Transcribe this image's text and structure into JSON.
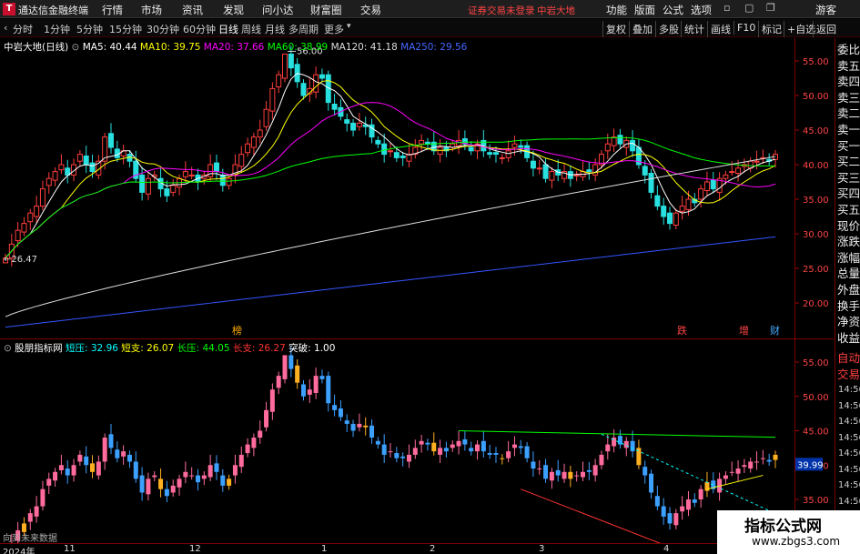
{
  "app": {
    "logo": "T",
    "name": "通达信金融终端",
    "menu": [
      "行情",
      "市场",
      "资讯",
      "发现",
      "问小达",
      "财富圈",
      "交易"
    ],
    "warning": "证券交易未登录",
    "stock_name": "中岩大地",
    "right_menu": [
      "功能",
      "版面",
      "公式",
      "选项"
    ],
    "guest": "游客"
  },
  "toolbar": {
    "periods": [
      "分时",
      "1分钟",
      "5分钟",
      "15分钟",
      "30分钟",
      "60分钟",
      "日线",
      "周线",
      "月线",
      "多周期",
      "更多"
    ],
    "active": "日线",
    "right": [
      "复权",
      "叠加",
      "多股",
      "统计",
      "画线",
      "F10",
      "标记",
      "+自选",
      "返回"
    ]
  },
  "main": {
    "title": "中岩大地(日线)",
    "ma": [
      {
        "label": "MA5: 40.44",
        "color": "#ffffff"
      },
      {
        "label": "MA10: 39.75",
        "color": "#ffff00"
      },
      {
        "label": "MA20: 37.66",
        "color": "#ff00ff"
      },
      {
        "label": "MA60: 38.99",
        "color": "#00ff00"
      },
      {
        "label": "MA120: 41.18",
        "color": "#dddddd"
      },
      {
        "label": "MA250: 29.56",
        "color": "#4466ff"
      }
    ],
    "high_label": "56.00",
    "low_label": "26.47",
    "events": [
      {
        "text": "榜",
        "color": "#ffaa00"
      },
      {
        "text": "跌",
        "color": "#ff4444"
      },
      {
        "text": "增",
        "color": "#ff4444"
      },
      {
        "text": "财",
        "color": "#44aaff"
      }
    ],
    "yticks": [
      "55.00",
      "50.00",
      "45.00",
      "40.00",
      "35.00",
      "30.00",
      "25.00",
      "20.00"
    ]
  },
  "indicator": {
    "title": "股朋指标网",
    "items": [
      {
        "label": "短压: 32.96",
        "color": "#00ffff"
      },
      {
        "label": "短支: 26.07",
        "color": "#ffff00"
      },
      {
        "label": "长压: 44.05",
        "color": "#00ff00"
      },
      {
        "label": "长支: 26.27",
        "color": "#ff3333"
      },
      {
        "label": "突破: 1.00",
        "color": "#ffffff"
      }
    ],
    "yticks": [
      "55.00",
      "50.00",
      "45.00",
      "40.00",
      "35.00"
    ],
    "price_box": "39.99",
    "future_label": "向到未来数据"
  },
  "right_panel": {
    "items": [
      "委比",
      "卖五",
      "卖四",
      "卖三",
      "卖二",
      "卖一",
      "买一",
      "买二",
      "买三",
      "买四",
      "买五",
      "现价",
      "涨跌",
      "涨幅",
      "总量",
      "外盘",
      "换手",
      "净资",
      "收益"
    ],
    "tabs": [
      "自动",
      "交易"
    ],
    "times": [
      "14:56",
      "14:56",
      "14:56",
      "14:56",
      "14:56",
      "14:56",
      "14:56",
      "14:56",
      "14:56"
    ]
  },
  "dates": [
    "2024年",
    "11",
    "12",
    "1",
    "2",
    "3",
    "4"
  ],
  "watermark": {
    "line1": "指标公式网",
    "line2": "www.zbgs3.com"
  },
  "chart_data": {
    "type": "candlestick",
    "close": [
      26.5,
      28.5,
      30.5,
      31.5,
      33,
      34,
      36.5,
      38,
      39,
      40,
      38.5,
      40,
      41.5,
      40,
      39,
      40.5,
      44,
      42.5,
      41,
      42,
      40.5,
      38,
      36,
      38,
      38.5,
      36.5,
      35.5,
      37,
      38,
      39,
      38.5,
      37.5,
      38.5,
      40,
      39,
      37,
      38,
      40,
      41.5,
      43,
      44,
      45,
      48,
      51,
      53,
      56,
      54,
      52,
      50,
      51,
      53,
      52.5,
      49,
      48,
      47,
      46,
      45,
      46,
      45.5,
      44,
      43,
      41.5,
      42,
      41,
      41,
      41.5,
      42.5,
      43.5,
      43,
      42,
      42.5,
      42,
      43,
      43.5,
      43,
      42,
      43,
      42,
      41.5,
      41.5,
      41,
      42,
      43,
      42.5,
      41,
      39.5,
      39.5,
      38,
      39,
      38.5,
      39,
      38,
      38.5,
      39,
      39,
      40,
      41.5,
      43,
      44,
      43,
      43.5,
      42,
      40,
      38.5,
      36,
      34,
      32.5,
      31.5,
      33,
      34,
      35,
      34.5,
      36.5,
      37.5,
      36.5,
      38,
      38.5,
      39,
      39.5,
      40,
      40.5,
      40.5,
      41,
      40.5,
      41.5
    ]
  }
}
